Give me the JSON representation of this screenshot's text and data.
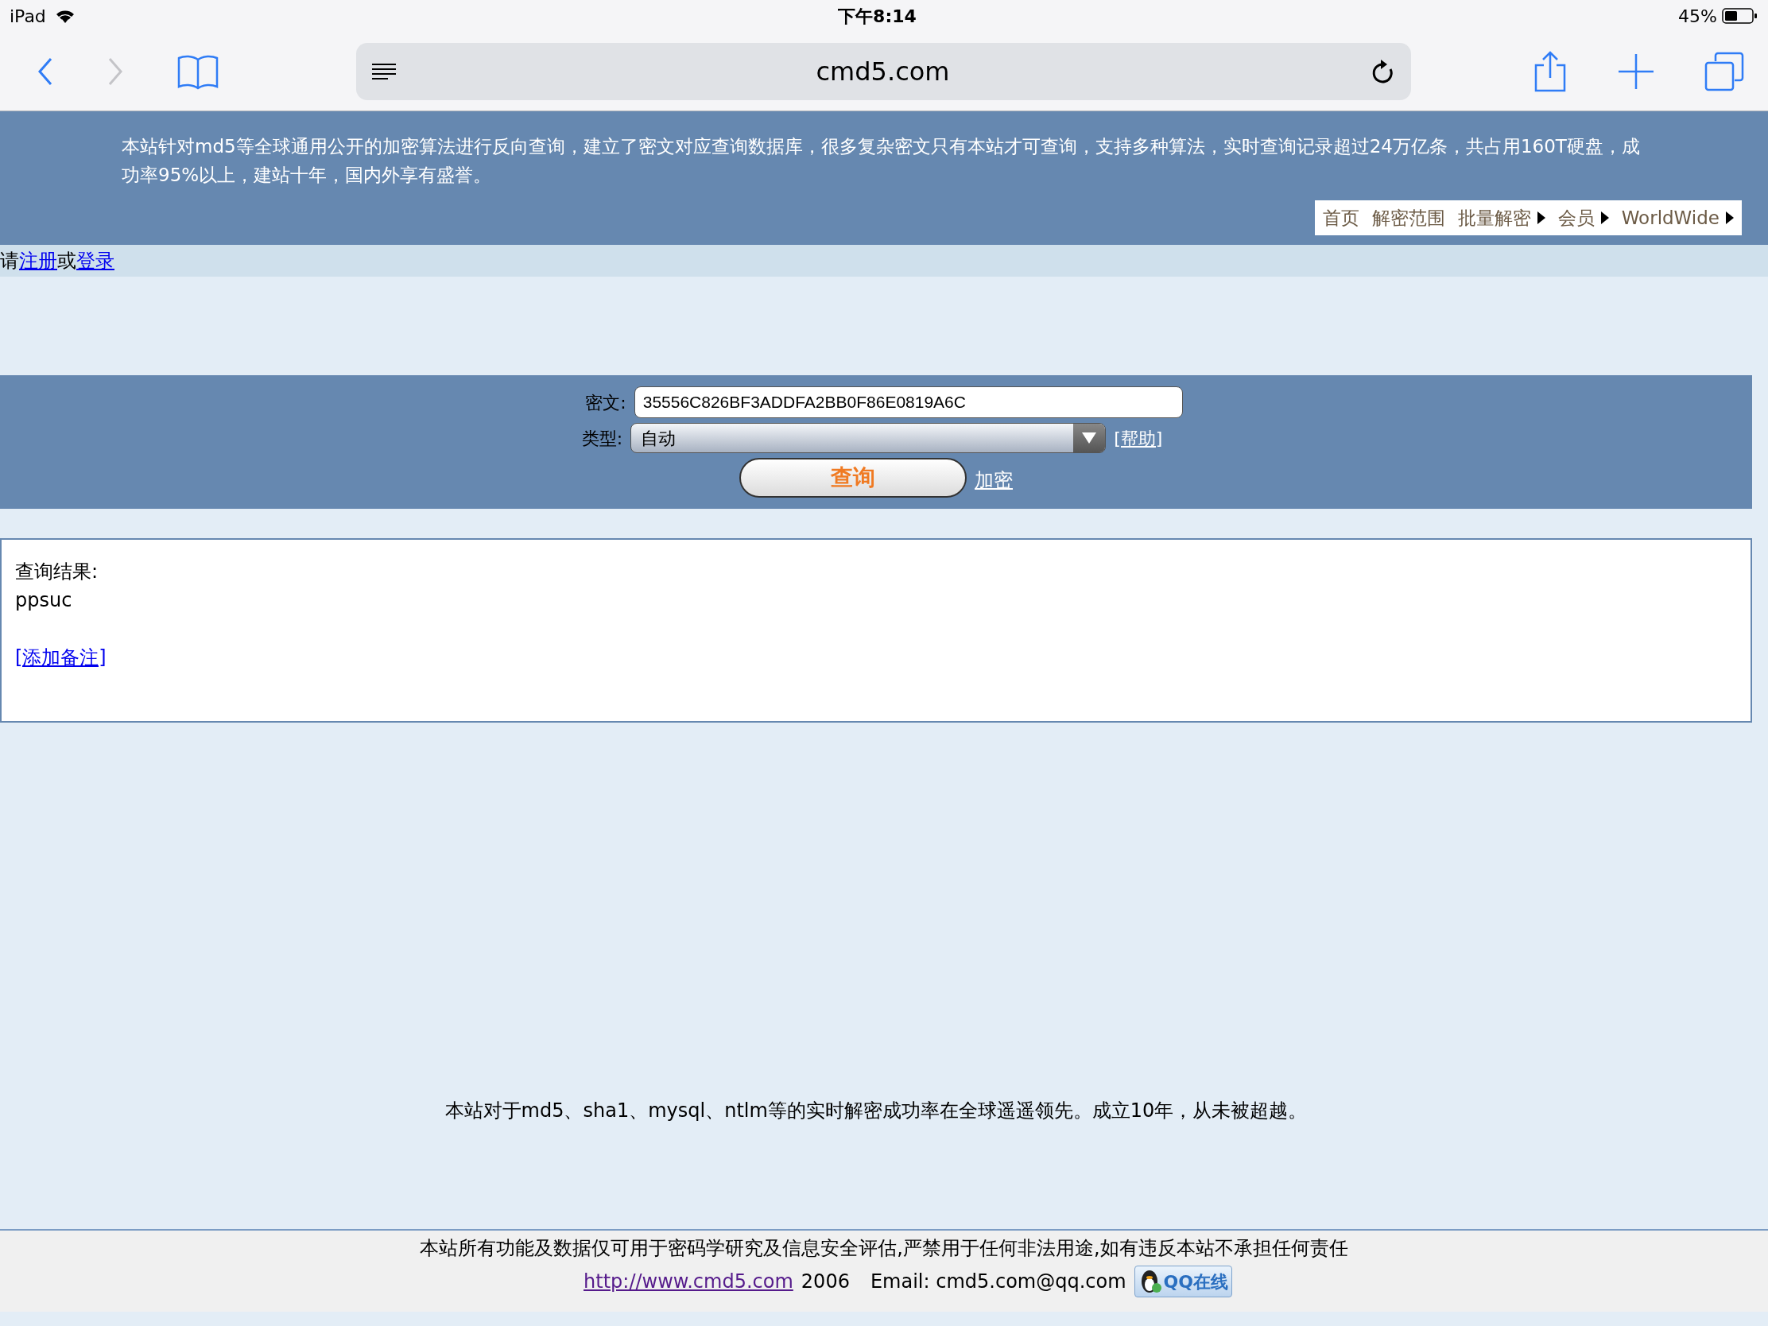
{
  "status_bar": {
    "device": "iPad",
    "time": "下午8:14",
    "battery": "45%"
  },
  "browser": {
    "url": "cmd5.com"
  },
  "banner": {
    "description": "本站针对md5等全球通用公开的加密算法进行反向查询，建立了密文对应查询数据库，很多复杂密文只有本站才可查询，支持多种算法，实时查询记录超过24万亿条，共占用160T硬盘，成功率95%以上，建站十年，国内外享有盛誉。",
    "nav": [
      {
        "label": "首页",
        "submenu": false
      },
      {
        "label": "解密范围",
        "submenu": false
      },
      {
        "label": "批量解密",
        "submenu": true
      },
      {
        "label": "会员",
        "submenu": true
      },
      {
        "label": "WorldWide",
        "submenu": true
      }
    ]
  },
  "login": {
    "prefix": "请",
    "register": "注册",
    "middle": "或",
    "login": "登录"
  },
  "form": {
    "ciphertext_label": "密文:",
    "ciphertext_value": "35556C826BF3ADDFA2BB0F86E0819A6C",
    "type_label": "类型:",
    "type_value": "自动",
    "help": "[帮助]",
    "submit": "查询",
    "encrypt": "加密"
  },
  "result": {
    "label": "查询结果:",
    "value": "ppsuc",
    "add_note": "[添加备注]"
  },
  "tagline": "本站对于md5、sha1、mysql、ntlm等的实时解密成功率在全球遥遥领先。成立10年，从未被超越。",
  "footer": {
    "disclaimer": "本站所有功能及数据仅可用于密码学研究及信息安全评估,严禁用于任何非法用途,如有违反本站不承担任何责任",
    "url": "http://www.cmd5.com",
    "year": "2006",
    "email": "Email: cmd5.com@qq.com",
    "qq_badge": "QQ在线"
  }
}
